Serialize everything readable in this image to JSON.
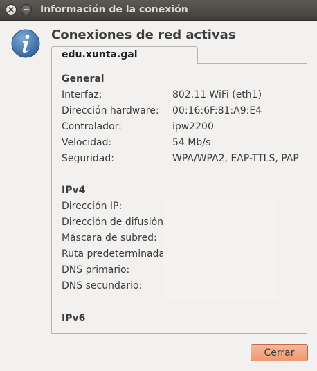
{
  "window": {
    "title": "Información de la conexión"
  },
  "header": {
    "heading": "Conexiones de red activas"
  },
  "tab": {
    "label": "edu.xunta.gal"
  },
  "general": {
    "title": "General",
    "rows": [
      {
        "label": "Interfaz:",
        "value": "802.11 WiFi (eth1)"
      },
      {
        "label": "Dirección hardware:",
        "value": "00:16:6F:81:A9:E4"
      },
      {
        "label": "Controlador:",
        "value": "ipw2200"
      },
      {
        "label": "Velocidad:",
        "value": "54 Mb/s"
      },
      {
        "label": "Seguridad:",
        "value": "WPA/WPA2, EAP-TTLS, PAP"
      }
    ]
  },
  "ipv4": {
    "title": "IPv4",
    "rows": [
      {
        "label": "Dirección IP:"
      },
      {
        "label": "Dirección de difusión:"
      },
      {
        "label": "Máscara de subred:"
      },
      {
        "label": "Ruta predeterminada"
      },
      {
        "label": "DNS primario:"
      },
      {
        "label": "DNS secundario:"
      }
    ]
  },
  "ipv6": {
    "title": "IPv6"
  },
  "buttons": {
    "close": "Cerrar"
  },
  "icons": {
    "info": "info-icon",
    "window_close": "close-icon",
    "window_minimize": "minimize-icon"
  },
  "colors": {
    "titlebar": "#4a4945",
    "accent_button": "#f0a07c",
    "info_icon": "#3b6ea5"
  }
}
